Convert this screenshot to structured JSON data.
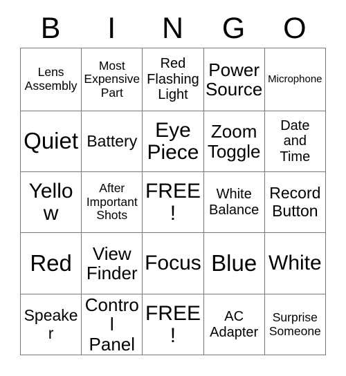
{
  "card": {
    "header_letters": [
      "B",
      "I",
      "N",
      "G",
      "O"
    ],
    "rows": [
      [
        {
          "text": "Lens\nAssembly",
          "size": "sm"
        },
        {
          "text": "Most\nExpensive\nPart",
          "size": "sm"
        },
        {
          "text": "Red\nFlashing\nLight",
          "size": "md"
        },
        {
          "text": "Power\nSource",
          "size": "xl"
        },
        {
          "text": "Microphone",
          "size": "xs"
        }
      ],
      [
        {
          "text": "Quiet",
          "size": "huge"
        },
        {
          "text": "Battery",
          "size": "lg"
        },
        {
          "text": "Eye\nPiece",
          "size": "xxl"
        },
        {
          "text": "Zoom\nToggle",
          "size": "xl"
        },
        {
          "text": "Date\nand\nTime",
          "size": "md"
        }
      ],
      [
        {
          "text": "Yellow",
          "size": "xxl"
        },
        {
          "text": "After\nImportant\nShots",
          "size": "sm"
        },
        {
          "text": "FREE!",
          "size": "xxl"
        },
        {
          "text": "White\nBalance",
          "size": "md"
        },
        {
          "text": "Record\nButton",
          "size": "lg"
        }
      ],
      [
        {
          "text": "Red",
          "size": "huge"
        },
        {
          "text": "View\nFinder",
          "size": "xl"
        },
        {
          "text": "Focus",
          "size": "xxl"
        },
        {
          "text": "Blue",
          "size": "huge"
        },
        {
          "text": "White",
          "size": "xxl"
        }
      ],
      [
        {
          "text": "Speaker",
          "size": "lg"
        },
        {
          "text": "Control\nPanel",
          "size": "xl"
        },
        {
          "text": "FREE!",
          "size": "xxl"
        },
        {
          "text": "AC\nAdapter",
          "size": "md"
        },
        {
          "text": "Surprise\nSomeone",
          "size": "sm"
        }
      ]
    ],
    "colors": {
      "background": "#ffffff",
      "text": "#000000",
      "grid_line": "#7a7a7a"
    }
  }
}
